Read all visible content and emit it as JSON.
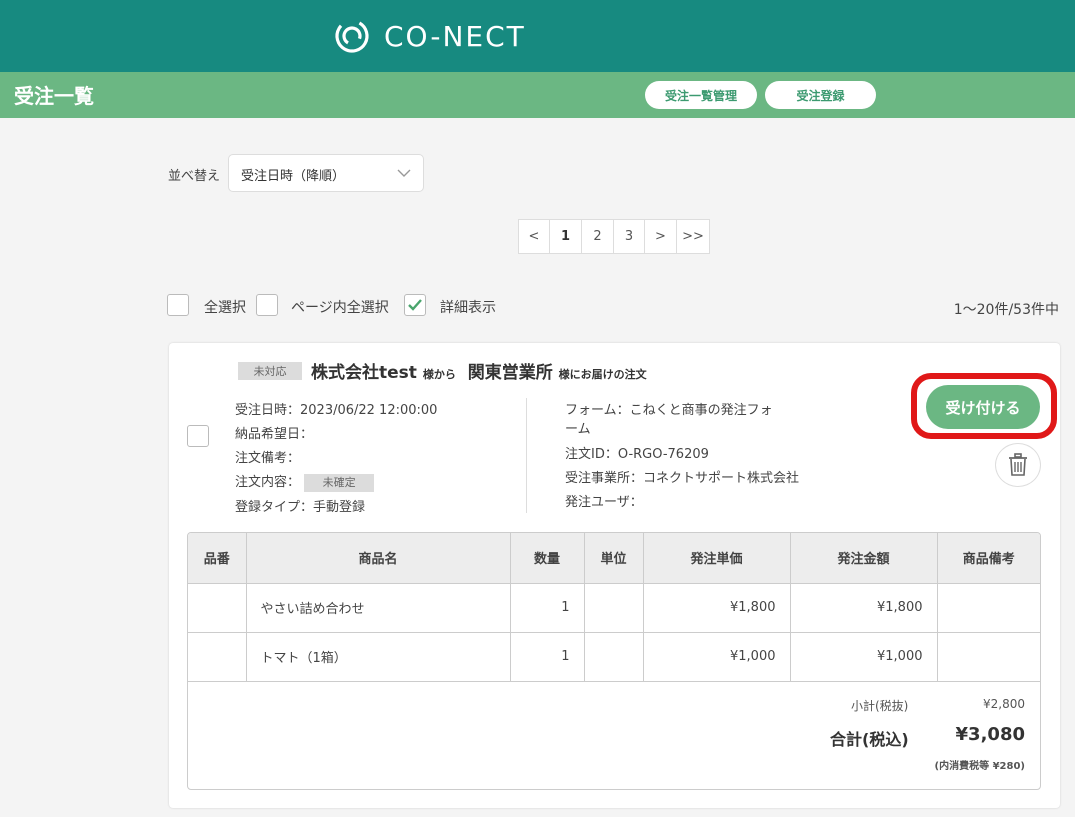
{
  "header": {
    "brand": "CO-NECT",
    "brand_color": "#178a80"
  },
  "subheader": {
    "title": "受注一覧",
    "buttons": [
      "受注一覧管理",
      "受注登録"
    ],
    "color": "#6bb783"
  },
  "sort": {
    "label": "並べ替え",
    "value": "受注日時（降順）"
  },
  "pagination": {
    "prev": "<",
    "pages": [
      "1",
      "2",
      "3"
    ],
    "current": "1",
    "next": ">",
    "last": ">>"
  },
  "selection": {
    "select_all": "全選択",
    "select_page": "ページ内全選択",
    "detail_view": "詳細表示",
    "detail_view_checked": true,
    "count": "1〜20件/53件中"
  },
  "order": {
    "status": "未対応",
    "company": "株式会社test",
    "from_suffix": "様から",
    "destination": "関東営業所",
    "dest_suffix": "様にお届けの注文",
    "left_info": {
      "order_date": "受注日時：2023/06/22 12:00:00",
      "delivery_date": "納品希望日：",
      "order_note": "注文備考：",
      "content_label": "注文内容：",
      "content_badge": "未確定",
      "register_type": "登録タイプ：手動登録"
    },
    "right_info": {
      "form_line1": "フォーム：こねくと商事の発注フォ",
      "form_line2": "ーム",
      "order_id": "注文ID：O-RGO-76209",
      "office": "受注事業所：コネクトサポート株式会社",
      "user": "発注ユーザ："
    },
    "accept_button": "受け付ける",
    "table": {
      "headers": [
        "品番",
        "商品名",
        "数量",
        "単位",
        "発注単価",
        "発注金額",
        "商品備考"
      ],
      "rows": [
        [
          "",
          "やさい詰め合わせ",
          "1",
          "",
          "¥1,800",
          "¥1,800",
          ""
        ],
        [
          "",
          "トマト（1箱）",
          "1",
          "",
          "¥1,000",
          "¥1,000",
          ""
        ]
      ]
    },
    "summary": {
      "subtotal_label": "小計(税抜)",
      "subtotal": "¥2,800",
      "total_label": "合計(税込)",
      "total": "¥3,080",
      "tax_note": "(内消費税等 ¥280)"
    }
  },
  "colors": {
    "accent": "#6bb783",
    "highlight_ring": "#e01818"
  }
}
